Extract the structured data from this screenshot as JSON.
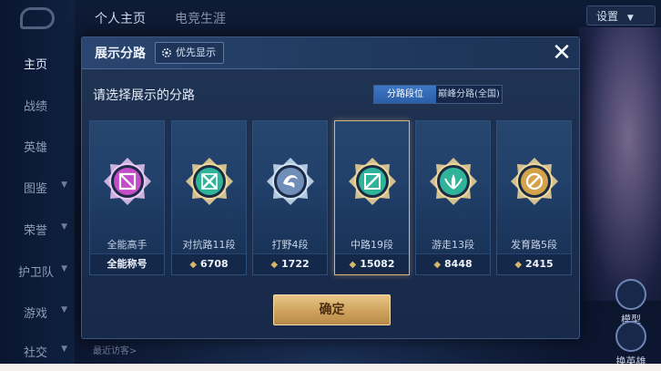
{
  "background": {
    "top_tabs": [
      "个人主页",
      "电竞生涯"
    ],
    "settings_label": "设置",
    "sidebar": [
      {
        "label": "主页",
        "active": true
      },
      {
        "label": "战绩",
        "active": false
      },
      {
        "label": "英雄",
        "active": false
      },
      {
        "label": "图鉴",
        "active": false
      },
      {
        "label": "荣誉",
        "active": false
      },
      {
        "label": "护卫队",
        "active": false
      },
      {
        "label": "游戏",
        "active": false
      },
      {
        "label": "社交",
        "active": false
      }
    ],
    "right_buttons": [
      "模型",
      "换英雄"
    ],
    "footer_text": "最近访客>"
  },
  "modal": {
    "title": "展示分路",
    "priority_label": "优先显示",
    "close_icon": "close-icon",
    "prompt": "请选择展示的分路",
    "segments": [
      "分路段位",
      "巅峰分路(全国)"
    ],
    "selected_segment": 0,
    "cards": [
      {
        "label": "全能高手",
        "stat": "全能称号",
        "has_gem": false,
        "selected": false,
        "icon": "all-round-badge",
        "color": "#c34cc9"
      },
      {
        "label": "对抗路11段",
        "stat": "6708",
        "has_gem": true,
        "selected": false,
        "icon": "clash-lane-badge",
        "color": "#2fb49a"
      },
      {
        "label": "打野4段",
        "stat": "1722",
        "has_gem": true,
        "selected": false,
        "icon": "jungle-badge",
        "color": "#6f8fb8"
      },
      {
        "label": "中路19段",
        "stat": "15082",
        "has_gem": true,
        "selected": true,
        "icon": "mid-lane-badge",
        "color": "#2fb49a"
      },
      {
        "label": "游走13段",
        "stat": "8448",
        "has_gem": true,
        "selected": false,
        "icon": "roam-badge",
        "color": "#2fb49a"
      },
      {
        "label": "发育路5段",
        "stat": "2415",
        "has_gem": true,
        "selected": false,
        "icon": "farm-lane-badge",
        "color": "#d4a24a"
      }
    ],
    "confirm_label": "确定"
  }
}
